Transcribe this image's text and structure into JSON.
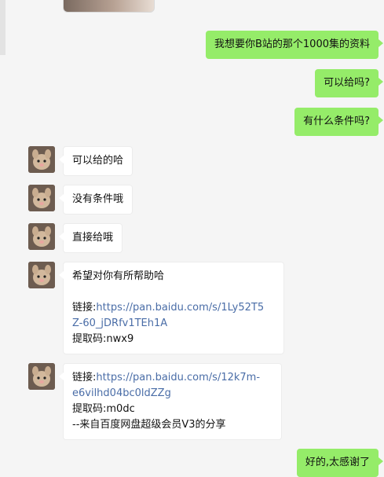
{
  "messages": {
    "m1": "我想要你B站的那个1000集的资料",
    "m2": "可以给吗?",
    "m3": "有什么条件吗?",
    "r1": "可以给的哈",
    "r2": "没有条件哦",
    "r3": "直接给哦",
    "r4_line1": "希望对你有所帮助哈",
    "r4_link_label": "链接:",
    "r4_link_part1": "https://pan.baidu.com/s/1Ly52T5",
    "r4_link_part2": "Z-60_jDRfv1TEh1A",
    "r4_code": "提取码:nwx9",
    "r5_link_label": "链接:",
    "r5_link_part1": "https://pan.baidu.com/s/12k7m-",
    "r5_link_part2": "e6vilhd04bc0ldZZg",
    "r5_code": "提取码:m0dc",
    "r5_source": "--来自百度网盘超级会员V3的分享",
    "m4": "好的,太感谢了"
  },
  "colors": {
    "my_bubble": "#95ec69",
    "their_bubble": "#ffffff",
    "link": "#4a6da7",
    "background": "#f5f5f5"
  },
  "icons": {
    "avatar": "plush-toy-avatar-icon"
  }
}
